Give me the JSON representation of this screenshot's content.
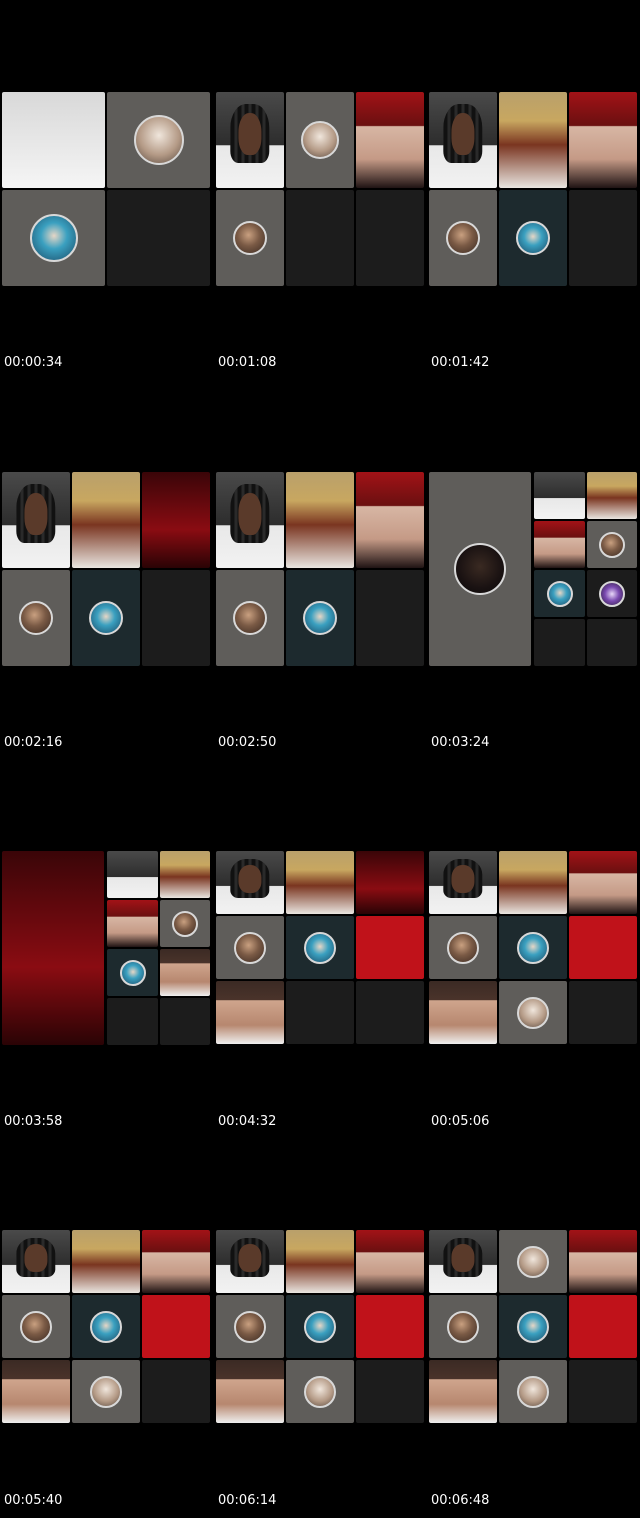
{
  "thumbnails": [
    {
      "timestamp": "00:00:34"
    },
    {
      "timestamp": "00:01:08"
    },
    {
      "timestamp": "00:01:42"
    },
    {
      "timestamp": "00:02:16"
    },
    {
      "timestamp": "00:02:50"
    },
    {
      "timestamp": "00:03:24"
    },
    {
      "timestamp": "00:03:58"
    },
    {
      "timestamp": "00:04:32"
    },
    {
      "timestamp": "00:05:06"
    },
    {
      "timestamp": "00:05:40"
    },
    {
      "timestamp": "00:06:14"
    },
    {
      "timestamp": "00:06:48"
    }
  ],
  "colors": {
    "background": "#000000",
    "text": "#ffffff",
    "accent_red": "#c0121a"
  }
}
